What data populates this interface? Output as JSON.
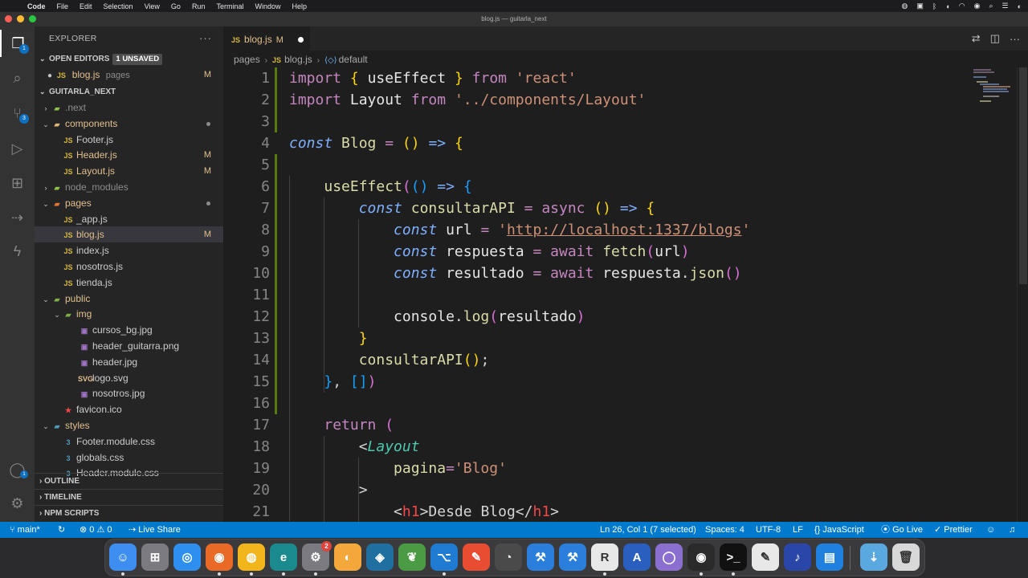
{
  "menubar": {
    "app": "Code",
    "items": [
      "File",
      "Edit",
      "Selection",
      "View",
      "Go",
      "Run",
      "Terminal",
      "Window",
      "Help"
    ]
  },
  "window": {
    "title": "blog.js — guitarla_next"
  },
  "activity": {
    "explorer_badge": "1",
    "scm_badge": "3"
  },
  "sidebar": {
    "title": "EXPLORER",
    "open_editors_label": "OPEN EDITORS",
    "unsaved_badge": "1 UNSAVED",
    "open_editor": {
      "name": "blog.js",
      "hint": "pages",
      "status": "M"
    },
    "project_label": "GUITARLA_NEXT",
    "tree": [
      {
        "name": ".next",
        "indent": 1,
        "kind": "folder",
        "open": false,
        "dim": true
      },
      {
        "name": "components",
        "indent": 1,
        "kind": "folder",
        "open": true,
        "dot": true
      },
      {
        "name": "Footer.js",
        "indent": 2,
        "kind": "js"
      },
      {
        "name": "Header.js",
        "indent": 2,
        "kind": "js",
        "status": "M"
      },
      {
        "name": "Layout.js",
        "indent": 2,
        "kind": "js",
        "status": "M"
      },
      {
        "name": "node_modules",
        "indent": 1,
        "kind": "folder",
        "open": false,
        "dim": true
      },
      {
        "name": "pages",
        "indent": 1,
        "kind": "folder",
        "open": true,
        "dot": true
      },
      {
        "name": "_app.js",
        "indent": 2,
        "kind": "js"
      },
      {
        "name": "blog.js",
        "indent": 2,
        "kind": "js",
        "status": "M",
        "selected": true
      },
      {
        "name": "index.js",
        "indent": 2,
        "kind": "js"
      },
      {
        "name": "nosotros.js",
        "indent": 2,
        "kind": "js"
      },
      {
        "name": "tienda.js",
        "indent": 2,
        "kind": "js"
      },
      {
        "name": "public",
        "indent": 1,
        "kind": "folder",
        "open": true
      },
      {
        "name": "img",
        "indent": 2,
        "kind": "folder",
        "open": true
      },
      {
        "name": "cursos_bg.jpg",
        "indent": 3,
        "kind": "img"
      },
      {
        "name": "header_guitarra.png",
        "indent": 3,
        "kind": "img"
      },
      {
        "name": "header.jpg",
        "indent": 3,
        "kind": "img"
      },
      {
        "name": "logo.svg",
        "indent": 3,
        "kind": "svg"
      },
      {
        "name": "nosotros.jpg",
        "indent": 3,
        "kind": "img"
      },
      {
        "name": "favicon.ico",
        "indent": 2,
        "kind": "ico"
      },
      {
        "name": "styles",
        "indent": 1,
        "kind": "folder",
        "open": true
      },
      {
        "name": "Footer.module.css",
        "indent": 2,
        "kind": "css"
      },
      {
        "name": "globals.css",
        "indent": 2,
        "kind": "css"
      },
      {
        "name": "Header.module.css",
        "indent": 2,
        "kind": "css"
      }
    ],
    "outline_label": "OUTLINE",
    "timeline_label": "TIMELINE",
    "npm_label": "NPM SCRIPTS"
  },
  "editor": {
    "tab": {
      "name": "blog.js",
      "status": "M"
    },
    "breadcrumb": {
      "folder": "pages",
      "file": "blog.js",
      "symbol": "default"
    },
    "line_numbers": [
      "1",
      "2",
      "3",
      "4",
      "5",
      "6",
      "7",
      "8",
      "9",
      "10",
      "11",
      "12",
      "13",
      "14",
      "15",
      "16",
      "17",
      "18",
      "19",
      "20",
      "21"
    ]
  },
  "status": {
    "branch": "main*",
    "problems": "0",
    "warnings": "0",
    "live_share": "Live Share",
    "position": "Ln 26, Col 1 (7 selected)",
    "spaces": "Spaces: 4",
    "encoding": "UTF-8",
    "eol": "LF",
    "language": "JavaScript",
    "go_live": "Go Live",
    "prettier": "Prettier"
  },
  "dock": {
    "settings_badge": "2",
    "apps": [
      "finder-icon",
      "launchpad-icon",
      "safari-icon",
      "firefox-icon",
      "chrome-icon",
      "edge-icon",
      "system-preferences-icon",
      "tableplus-icon",
      "mysql-workbench-icon",
      "mongodb-compass-icon",
      "vscode-icon",
      "git-icon",
      "github-desktop-icon",
      "xcode-icon",
      "xcode-simulator-icon",
      "rstudio-icon",
      "altool-icon",
      "colorsync-icon",
      "obs-icon",
      "terminal-icon",
      "text-edit-icon",
      "audacity-icon",
      "keynote-icon",
      "downloads-icon",
      "trash-icon"
    ]
  }
}
